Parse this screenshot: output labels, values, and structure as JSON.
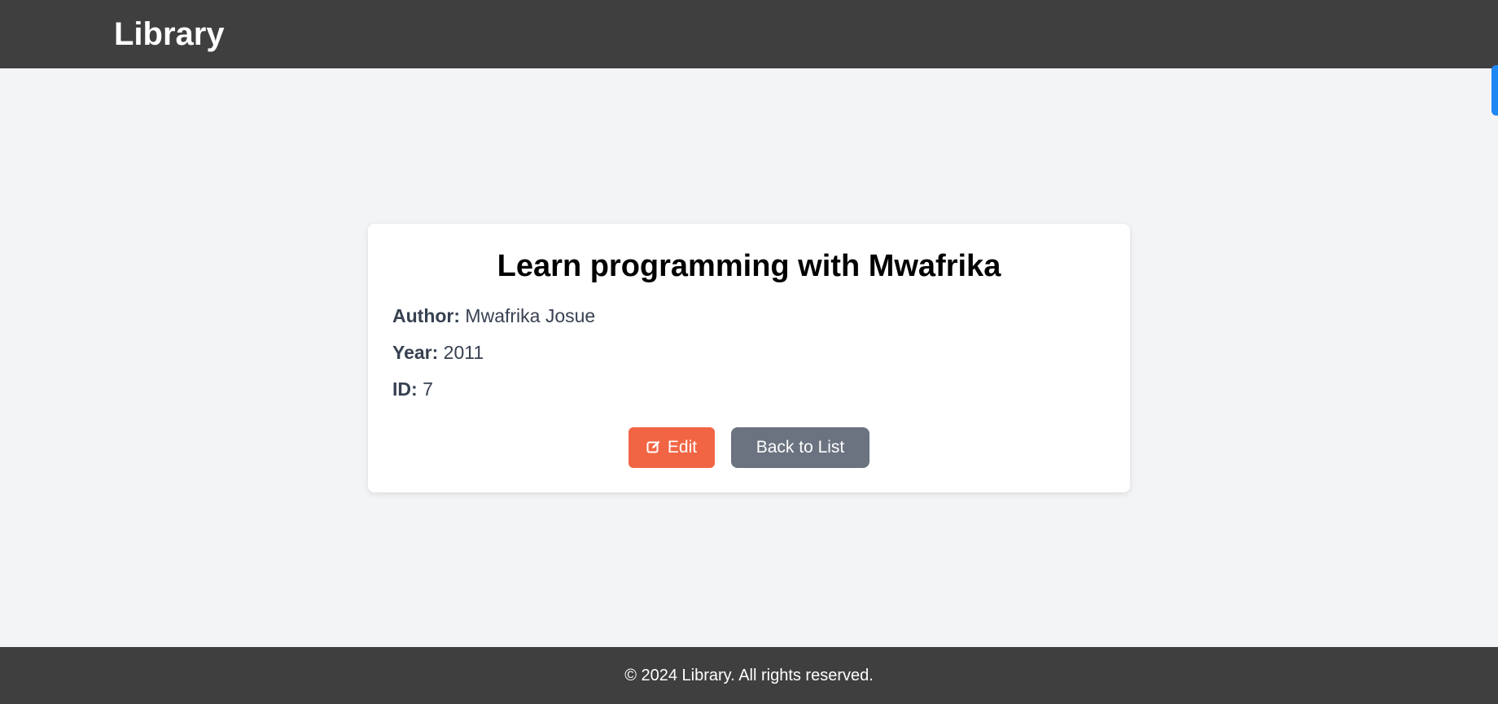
{
  "header": {
    "brand": "Library"
  },
  "book": {
    "title": "Learn programming with Mwafrika",
    "author_label": "Author:",
    "author": "Mwafrika Josue",
    "year_label": "Year:",
    "year": "2011",
    "id_label": "ID:",
    "id": "7"
  },
  "actions": {
    "edit_label": "Edit",
    "edit_icon": "edit-icon",
    "back_label": "Back to List"
  },
  "footer": {
    "text": "© 2024 Library. All rights reserved."
  },
  "colors": {
    "header_bg": "#3f3f3f",
    "edit_button": "#f26544",
    "back_button": "#6b7280",
    "side_tab": "#1e88f5"
  }
}
